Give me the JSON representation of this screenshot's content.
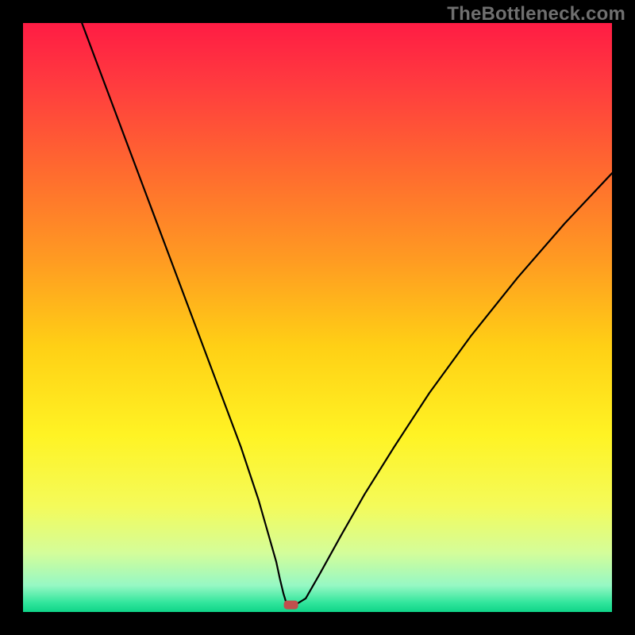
{
  "watermark": "TheBottleneck.com",
  "chart_data": {
    "type": "line",
    "title": "",
    "xlabel": "",
    "ylabel": "",
    "xlim": [
      0,
      100
    ],
    "ylim": [
      0,
      100
    ],
    "grid": false,
    "legend": false,
    "series": [
      {
        "name": "curve",
        "x": [
          10,
          13,
          16,
          19,
          22,
          25,
          28,
          31,
          34,
          37,
          40,
          41,
          42,
          43,
          43.6,
          44.2,
          44.8,
          46.2,
          48.0,
          50.4,
          54.0,
          58.0,
          63.0,
          69.0,
          76.0,
          84.0,
          92.0,
          100.0
        ],
        "y": [
          100,
          92,
          84,
          76,
          68,
          60,
          52,
          44,
          36,
          28,
          19,
          15.5,
          12,
          8.5,
          5.7,
          3.2,
          1.2,
          1.2,
          2.3,
          6.5,
          13.0,
          20.0,
          28.0,
          37.2,
          46.8,
          56.8,
          66.0,
          74.5
        ]
      }
    ],
    "marker": {
      "x": 45.5,
      "y": 1.2,
      "shape": "rounded-rect",
      "color": "#c0504d"
    },
    "background_gradient": {
      "stops": [
        {
          "offset": 0.0,
          "color": "#ff1c44"
        },
        {
          "offset": 0.1,
          "color": "#ff3a3f"
        },
        {
          "offset": 0.25,
          "color": "#ff6a2f"
        },
        {
          "offset": 0.4,
          "color": "#ff9a22"
        },
        {
          "offset": 0.55,
          "color": "#ffd015"
        },
        {
          "offset": 0.7,
          "color": "#fff324"
        },
        {
          "offset": 0.82,
          "color": "#f4fb5a"
        },
        {
          "offset": 0.9,
          "color": "#d4fd9a"
        },
        {
          "offset": 0.955,
          "color": "#96f8c4"
        },
        {
          "offset": 0.985,
          "color": "#2fe59b"
        },
        {
          "offset": 1.0,
          "color": "#0fd488"
        }
      ]
    }
  }
}
